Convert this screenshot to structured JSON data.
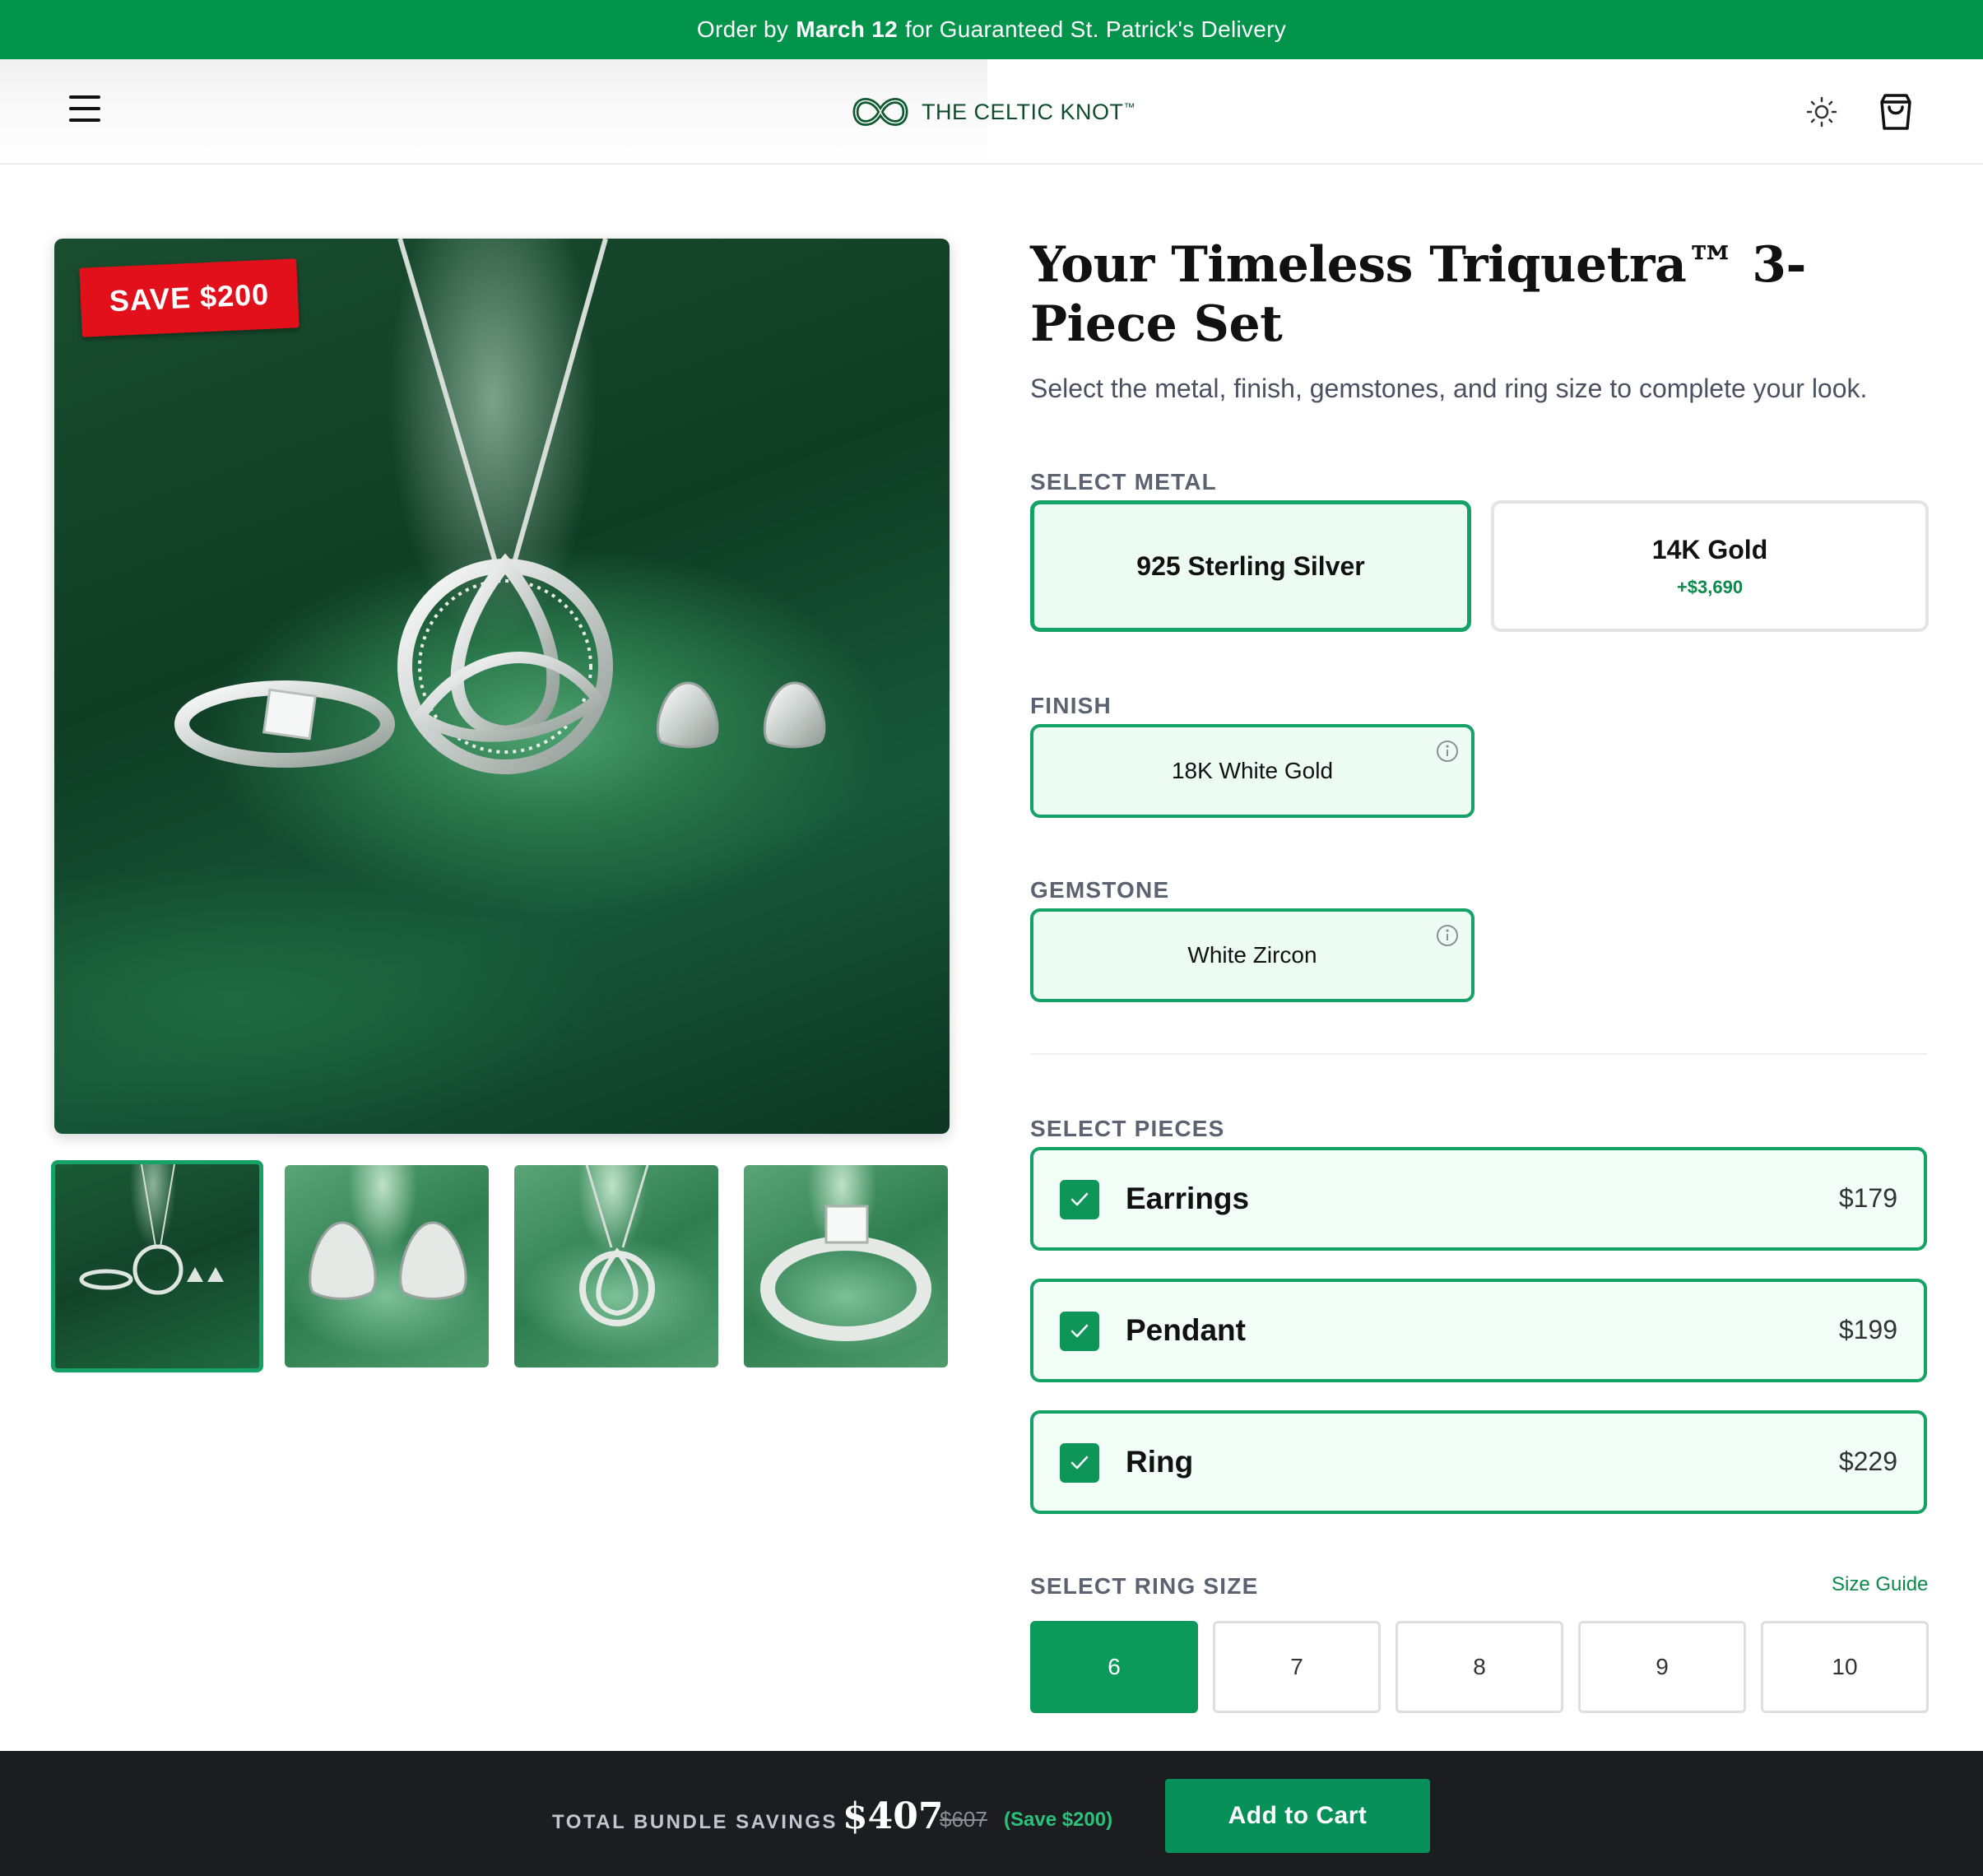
{
  "promo": {
    "prefix": "Order by",
    "date": "March 12",
    "suffix": "for Guaranteed St. Patrick's Delivery"
  },
  "header": {
    "brand": "THE CELTIC KNOT",
    "brand_mark": "™"
  },
  "gallery": {
    "badge": "SAVE $200",
    "thumbnails": [
      {
        "name": "Full set",
        "active": true
      },
      {
        "name": "Earrings",
        "active": false
      },
      {
        "name": "Pendant",
        "active": false
      },
      {
        "name": "Ring",
        "active": false
      }
    ]
  },
  "product": {
    "title": "Your Timeless Triquetra™ 3-Piece Set",
    "subtitle": "Select the metal, finish, gemstones, and ring size to complete your look."
  },
  "metal": {
    "label": "SELECT METAL",
    "options": [
      {
        "name": "925 Sterling Silver",
        "price": "",
        "selected": true
      },
      {
        "name": "14K Gold",
        "price": "+$3,690",
        "selected": false
      }
    ]
  },
  "finish": {
    "label": "FINISH",
    "value": "18K White Gold"
  },
  "gemstone": {
    "label": "GEMSTONE",
    "value": "White Zircon"
  },
  "pieces": {
    "label": "SELECT PIECES",
    "items": [
      {
        "name": "Earrings",
        "price": "$179",
        "checked": true
      },
      {
        "name": "Pendant",
        "price": "$199",
        "checked": true
      },
      {
        "name": "Ring",
        "price": "$229",
        "checked": true
      }
    ]
  },
  "ring_size": {
    "label": "SELECT RING SIZE",
    "guide": "Size Guide",
    "sizes": [
      "6",
      "7",
      "8",
      "9",
      "10"
    ],
    "selected": "6"
  },
  "summary": {
    "label": "TOTAL BUNDLE SAVINGS",
    "total": "$407",
    "was": "$607",
    "save": "(Save $200)",
    "cta": "Add to Cart"
  },
  "colors": {
    "brand_green": "#02944b",
    "accent_green": "#14a266",
    "sale_red": "#e1101a",
    "dark_bar": "#1c1d20"
  },
  "icons": [
    "menu-icon",
    "celtic-knot-logo-icon",
    "sun-icon",
    "shopping-bag-icon",
    "info-icon",
    "checkmark-icon"
  ]
}
